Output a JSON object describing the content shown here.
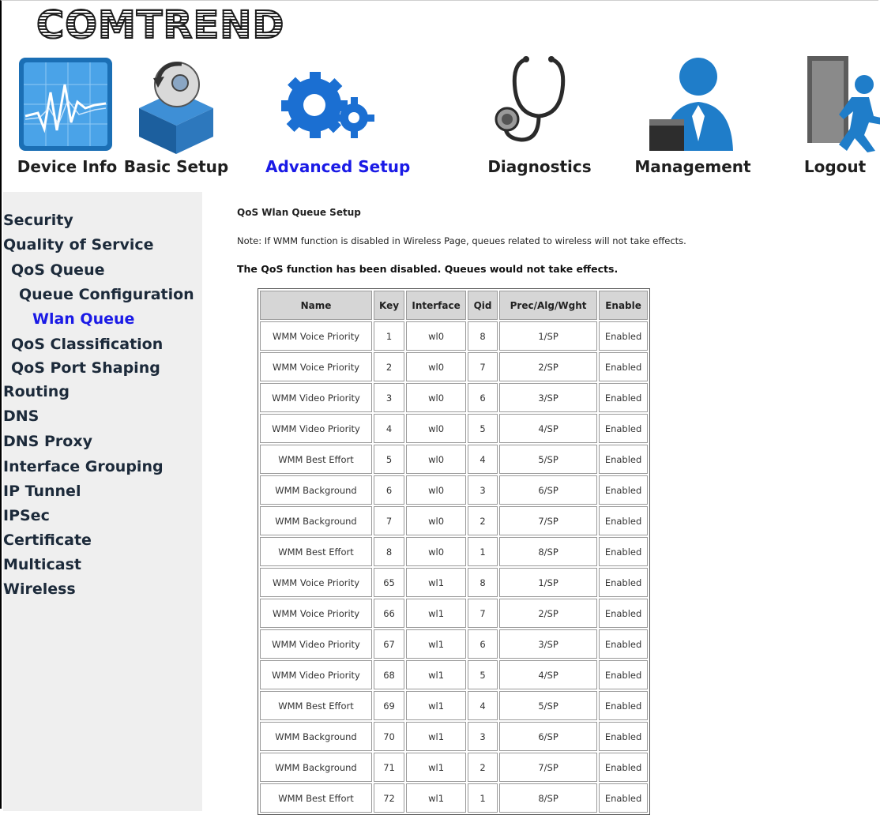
{
  "brand": {
    "logo_text": "COMTREND"
  },
  "nav": [
    {
      "label": "Device Info",
      "icon": "device-info-icon",
      "active": false
    },
    {
      "label": "Basic Setup",
      "icon": "basic-setup-icon",
      "active": false
    },
    {
      "label": "Advanced Setup",
      "icon": "advanced-setup-icon",
      "active": true
    },
    {
      "label": "Diagnostics",
      "icon": "diagnostics-icon",
      "active": false
    },
    {
      "label": "Management",
      "icon": "management-icon",
      "active": false
    },
    {
      "label": "Logout",
      "icon": "logout-icon",
      "active": false
    }
  ],
  "sidebar": {
    "items": [
      {
        "label": "Security",
        "active": false
      },
      {
        "label": "Quality of Service",
        "active": false
      },
      {
        "label": "QoS Queue",
        "active": false
      },
      {
        "label": "Queue Configuration",
        "active": false
      },
      {
        "label": "Wlan Queue",
        "active": true
      },
      {
        "label": "QoS Classification",
        "active": false
      },
      {
        "label": "QoS Port Shaping",
        "active": false
      },
      {
        "label": "Routing",
        "active": false
      },
      {
        "label": "DNS",
        "active": false
      },
      {
        "label": "DNS Proxy",
        "active": false
      },
      {
        "label": "Interface Grouping",
        "active": false
      },
      {
        "label": "IP Tunnel",
        "active": false
      },
      {
        "label": "IPSec",
        "active": false
      },
      {
        "label": "Certificate",
        "active": false
      },
      {
        "label": "Multicast",
        "active": false
      },
      {
        "label": "Wireless",
        "active": false
      }
    ]
  },
  "content": {
    "title": "QoS Wlan Queue Setup",
    "note": "Note: If WMM function is disabled in Wireless Page, queues related to wireless will not take effects.",
    "warning": "The QoS function has been disabled. Queues would not take effects.",
    "table": {
      "headers": [
        "Name",
        "Key",
        "Interface",
        "Qid",
        "Prec/Alg/Wght",
        "Enable"
      ],
      "rows": [
        [
          "WMM Voice Priority",
          "1",
          "wl0",
          "8",
          "1/SP",
          "Enabled"
        ],
        [
          "WMM Voice Priority",
          "2",
          "wl0",
          "7",
          "2/SP",
          "Enabled"
        ],
        [
          "WMM Video Priority",
          "3",
          "wl0",
          "6",
          "3/SP",
          "Enabled"
        ],
        [
          "WMM Video Priority",
          "4",
          "wl0",
          "5",
          "4/SP",
          "Enabled"
        ],
        [
          "WMM Best Effort",
          "5",
          "wl0",
          "4",
          "5/SP",
          "Enabled"
        ],
        [
          "WMM Background",
          "6",
          "wl0",
          "3",
          "6/SP",
          "Enabled"
        ],
        [
          "WMM Background",
          "7",
          "wl0",
          "2",
          "7/SP",
          "Enabled"
        ],
        [
          "WMM Best Effort",
          "8",
          "wl0",
          "1",
          "8/SP",
          "Enabled"
        ],
        [
          "WMM Voice Priority",
          "65",
          "wl1",
          "8",
          "1/SP",
          "Enabled"
        ],
        [
          "WMM Voice Priority",
          "66",
          "wl1",
          "7",
          "2/SP",
          "Enabled"
        ],
        [
          "WMM Video Priority",
          "67",
          "wl1",
          "6",
          "3/SP",
          "Enabled"
        ],
        [
          "WMM Video Priority",
          "68",
          "wl1",
          "5",
          "4/SP",
          "Enabled"
        ],
        [
          "WMM Best Effort",
          "69",
          "wl1",
          "4",
          "5/SP",
          "Enabled"
        ],
        [
          "WMM Background",
          "70",
          "wl1",
          "3",
          "6/SP",
          "Enabled"
        ],
        [
          "WMM Background",
          "71",
          "wl1",
          "2",
          "7/SP",
          "Enabled"
        ],
        [
          "WMM Best Effort",
          "72",
          "wl1",
          "1",
          "8/SP",
          "Enabled"
        ]
      ]
    }
  },
  "colors": {
    "active_link": "#1a1ae6",
    "sidebar_bg": "#efefef",
    "table_header_bg": "#d6d6d6"
  }
}
